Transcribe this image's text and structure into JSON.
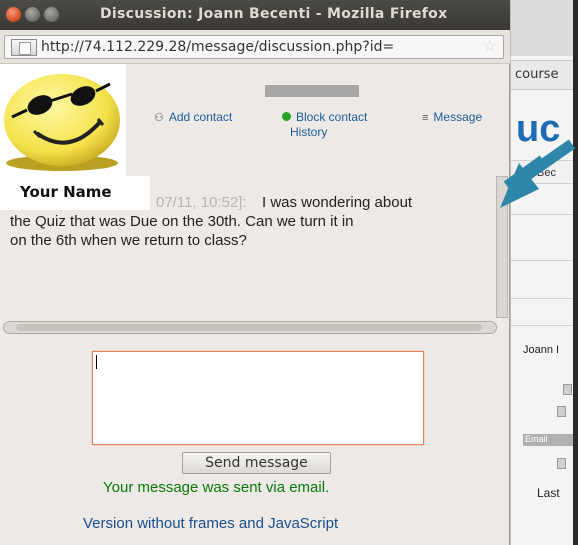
{
  "window": {
    "title": "Discussion: Joann Becenti - Mozilla Firefox",
    "url": "http://74.112.229.28/message/discussion.php?id="
  },
  "profile": {
    "name_label": "Your Name"
  },
  "actions": {
    "add_contact": "Add contact",
    "block_contact": "Block contact",
    "message_history_1": "Message",
    "message_history_2": "History"
  },
  "message": {
    "timestamp": "07/11, 10:52]:",
    "line1": "I was wondering about",
    "line2": "the Quiz that was Due on the 30th. Can we turn it in",
    "line3": "on the 6th when we return to class?"
  },
  "composer": {
    "value": "",
    "send_label": "Send message"
  },
  "status": {
    "sent": "Your message was sent via email."
  },
  "links": {
    "no_frames": "Version without frames and JavaScript"
  },
  "background_window": {
    "tab_text": "course",
    "heading_text": "uc",
    "subtab_text": "Bec",
    "name_text": "Joann I",
    "email_text": "Email",
    "last_text": "Last"
  },
  "colors": {
    "link": "#1c5c99",
    "success": "#0a7a0a",
    "arrow": "#2e86a8",
    "composer_border": "#e3845a"
  }
}
